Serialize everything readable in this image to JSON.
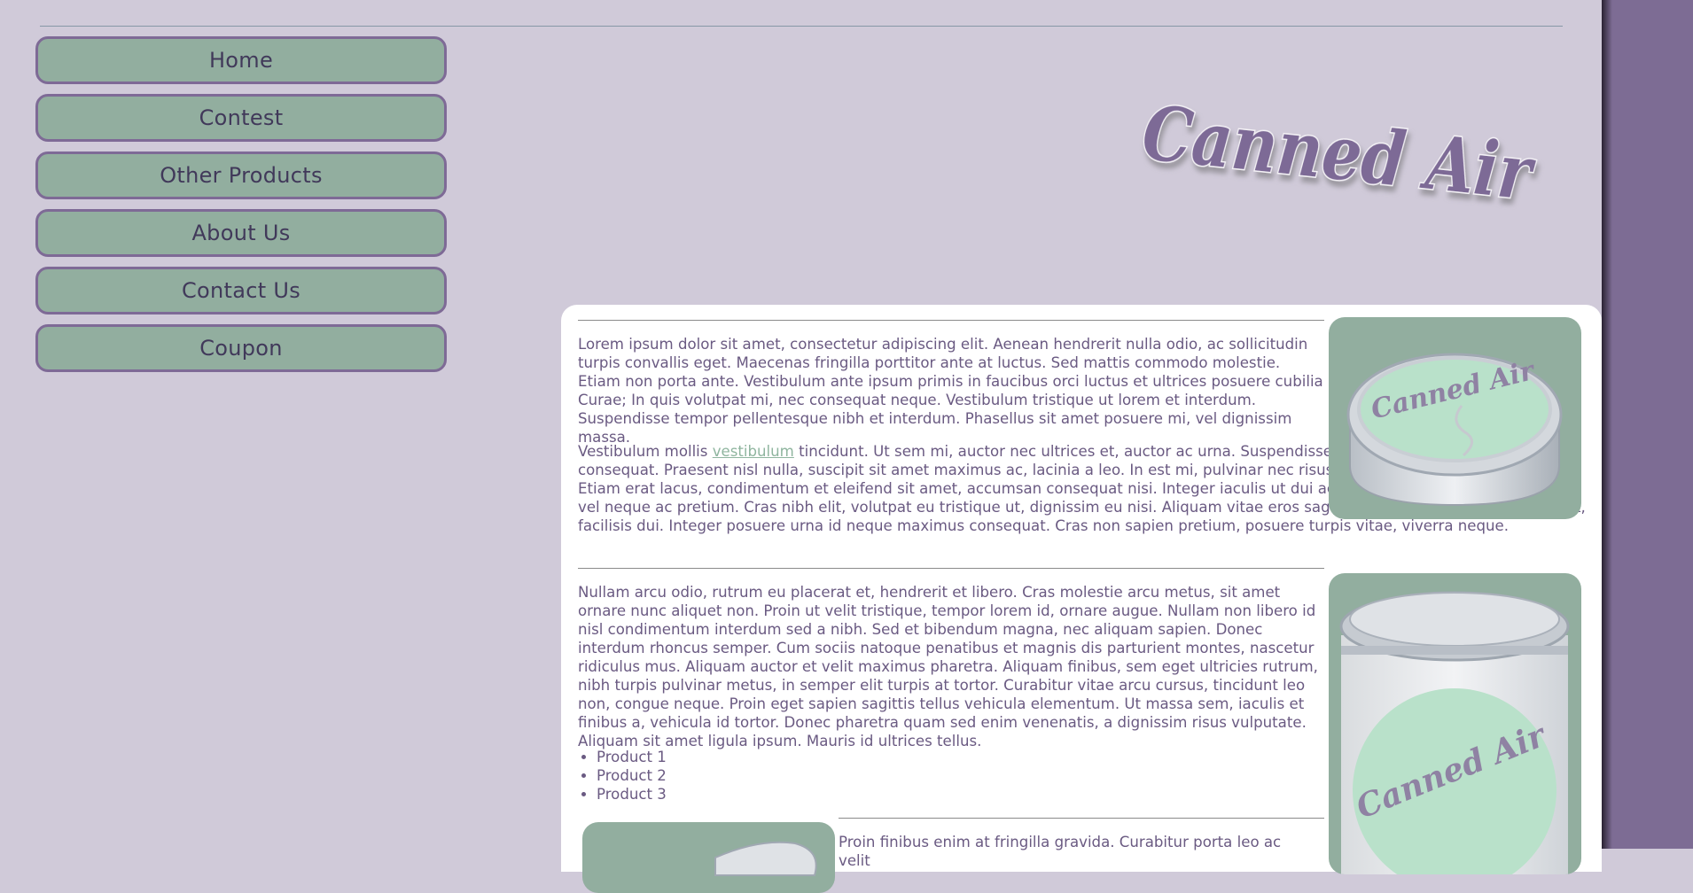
{
  "nav": {
    "items": [
      {
        "label": "Home"
      },
      {
        "label": "Contest"
      },
      {
        "label": "Other Products"
      },
      {
        "label": "About Us"
      },
      {
        "label": "Contact Us"
      },
      {
        "label": "Coupon"
      }
    ]
  },
  "header": {
    "logo_text": "Canned Air"
  },
  "content": {
    "para1": "Lorem ipsum dolor sit amet, consectetur adipiscing elit. Aenean hendrerit nulla odio, ac sollicitudin turpis convallis eget. Maecenas fringilla porttitor ante at luctus. Sed mattis commodo molestie. Etiam non porta ante. Vestibulum ante ipsum primis in faucibus orci luctus et ultrices posuere cubilia Curae; In quis volutpat mi, nec consequat neque. Vestibulum tristique ut lorem et interdum. Suspendisse tempor pellentesque nibh et interdum. Phasellus sit amet posuere mi, vel dignissim massa.",
    "para2_before": "Vestibulum mollis ",
    "para2_link": "vestibulum",
    "para2_after": " tincidunt. Ut sem mi, auctor nec ultrices et, auctor ac urna. Suspendisse potenti. Duis faucibus interdum consequat. Praesent nisl nulla, suscipit sit amet maximus ac, lacinia a leo. In est mi, pulvinar nec risus at, posuere ullamcorper nulla. Etiam erat lacus, condimentum et eleifend sit amet, accumsan consequat nisi. Integer iaculis ut dui ac imperdiet. Integer condimentum vel neque ac pretium. Cras nibh elit, volutpat eu tristique ut, dignissim eu nisi. Aliquam vitae eros sagittis, scelerisque mauris imperdiet, facilisis dui. Integer posuere urna id neque maximus consequat. Cras non sapien pretium, posuere turpis vitae, viverra neque.",
    "para3": "Nullam arcu odio, rutrum eu placerat et, hendrerit et libero. Cras molestie arcu metus, sit amet ornare nunc aliquet non. Proin ut velit tristique, tempor lorem id, ornare augue. Nullam non libero id nisl condimentum interdum sed a nibh. Sed et bibendum magna, nec aliquam sapien. Donec interdum rhoncus semper. Cum sociis natoque penatibus et magnis dis parturient montes, nascetur ridiculus mus. Aliquam auctor et velit maximus pharetra. Aliquam finibus, sem eget ultricies rutrum, nibh turpis pulvinar metus, in semper elit turpis at tortor. Curabitur vitae arcu cursus, tincidunt leo non, congue neque. Proin eget sapien sagittis tellus vehicula elementum. Ut massa sem, iaculis et finibus a, vehicula id tortor. Donec pharetra quam sed enim venenatis, a dignissim risus vulputate. Aliquam sit amet ligula ipsum. Mauris id ultrices tellus.",
    "products": [
      "Product 1",
      "Product 2",
      "Product 3"
    ],
    "para4": "Proin finibus enim at fringilla gravida. Curabitur porta leo ac velit"
  },
  "images": {
    "tin1_label": "Canned Air",
    "tin2_label": "Canned Air"
  },
  "colors": {
    "background": "#d0cad9",
    "nav_button": "#92ae9f",
    "nav_border": "#7e6a96",
    "accent": "#7d6c94",
    "link": "#8fb59f"
  }
}
